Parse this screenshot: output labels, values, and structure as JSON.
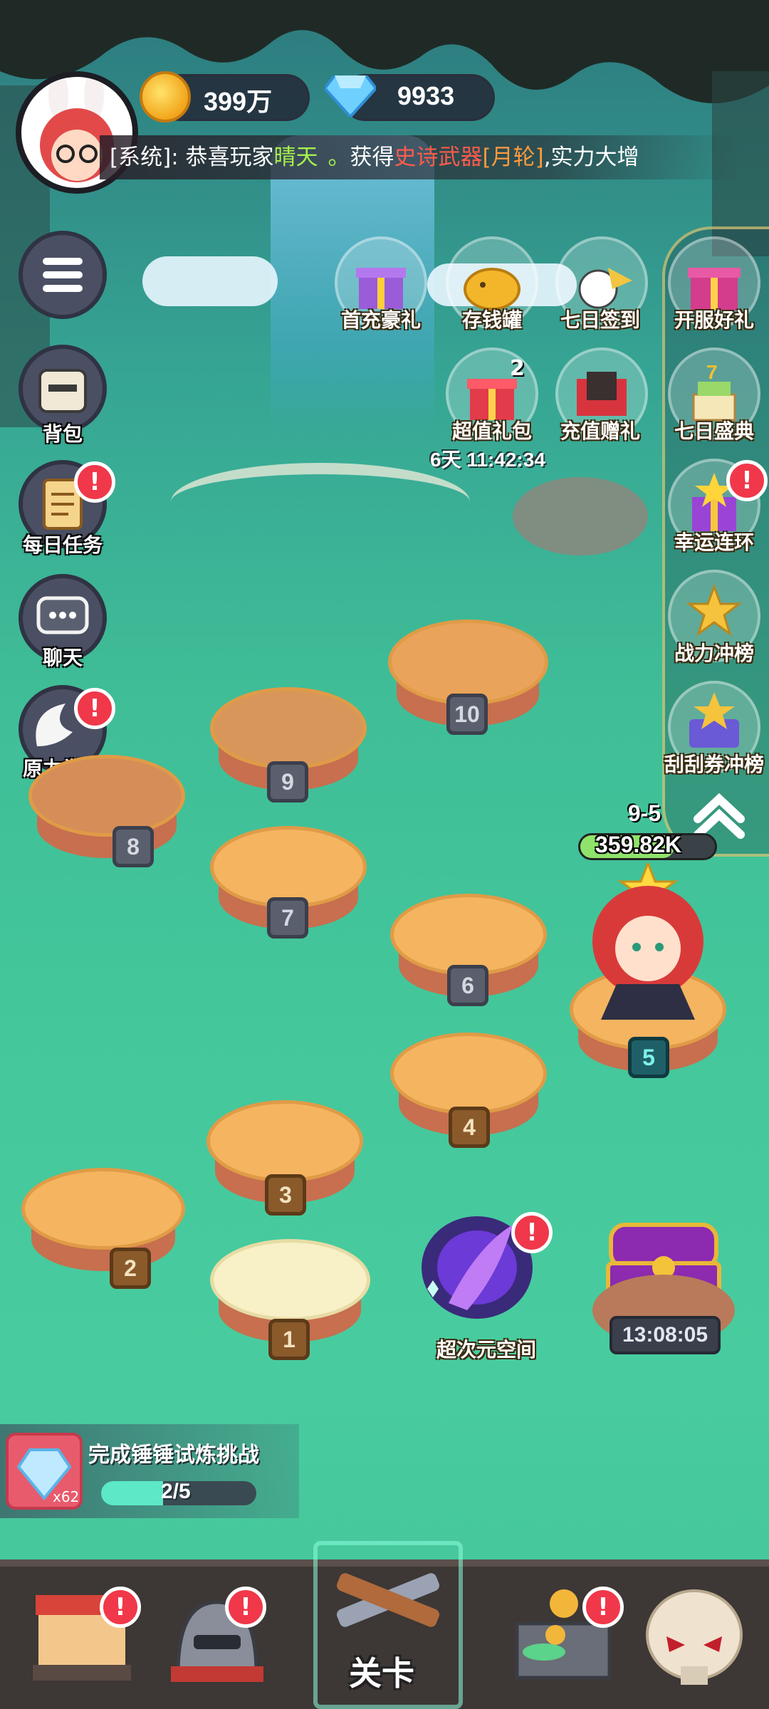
{
  "currency": {
    "gold": "399万",
    "diamonds": "9933"
  },
  "broadcast": {
    "prefix": "[系统]: 恭喜玩家",
    "player": "晴天",
    "dot": "。",
    "middle": "获得",
    "item_type": "史诗武器",
    "item_name": "[月轮]",
    "suffix": ",实力大增"
  },
  "left_menu": {
    "bag": "背包",
    "daily_tasks": "每日任务",
    "chat": "聊天",
    "force_awaken": "原力觉醒"
  },
  "events": {
    "first_recharge": "首充豪礼",
    "piggy_bank": "存钱罐",
    "seven_day_signin": "七日签到",
    "server_open_gift": "开服好礼",
    "value_pack": "超值礼包",
    "value_pack_count": "2",
    "value_pack_timer": "6天 11:42:34",
    "recharge_gift": "充值赠礼",
    "seven_day_festival": "七日盛典",
    "lucky_chain": "幸运连环",
    "power_ranking": "战力冲榜",
    "scratch_ranking": "刮刮券冲榜"
  },
  "badge_mark": "!",
  "player_stage": {
    "stage": "9-5",
    "power": "359.82K"
  },
  "levels": [
    "1",
    "2",
    "3",
    "4",
    "5",
    "6",
    "7",
    "8",
    "9",
    "10"
  ],
  "portal": {
    "label": "超次元空间"
  },
  "chest": {
    "timer": "13:08:05"
  },
  "quest": {
    "title": "完成锤锤试炼挑战",
    "reward_count": "x62",
    "progress_text": "2/5",
    "progress": 0.4
  },
  "nav": {
    "stage_label": "关卡"
  }
}
